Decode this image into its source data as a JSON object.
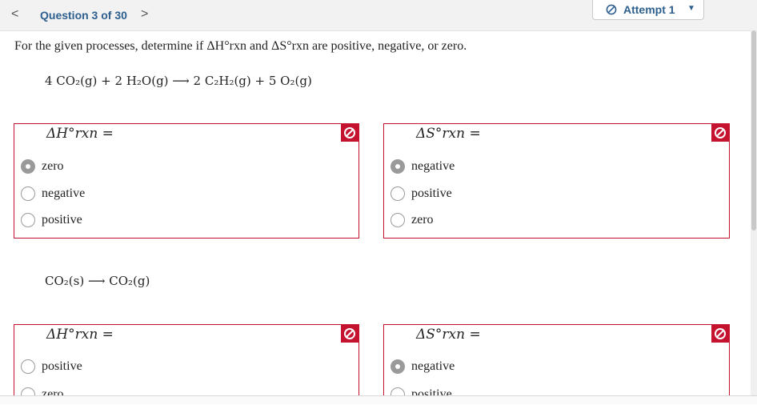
{
  "header": {
    "prev_label": "<",
    "question_title": "Question 3 of 30",
    "next_label": ">",
    "attempt_label": "Attempt 1",
    "attempt_caret": "▼"
  },
  "prompt": "For the given processes, determine if ΔH°rxn and ΔS°rxn are positive, negative, or zero.",
  "problems": [
    {
      "equation": "4 CO₂(g) + 2 H₂O(g) ⟶ 2 C₂H₂(g) + 5 O₂(g)",
      "dH_label": "ΔH°rxn =",
      "dS_label": "ΔS°rxn =",
      "dH_options": [
        "zero",
        "negative",
        "positive"
      ],
      "dH_selected": "zero",
      "dS_options": [
        "negative",
        "positive",
        "zero"
      ],
      "dS_selected": "negative"
    },
    {
      "equation": "CO₂(s) ⟶ CO₂(g)",
      "dH_label": "ΔH°rxn =",
      "dS_label": "ΔS°rxn =",
      "dH_options": [
        "positive",
        "zero"
      ],
      "dH_selected": "",
      "dS_options": [
        "negative",
        "positive"
      ],
      "dS_selected": "negative"
    }
  ],
  "status": {
    "incorrect_icon": "no-entry-circle-icon",
    "incorrect_color": "#c4122f"
  }
}
